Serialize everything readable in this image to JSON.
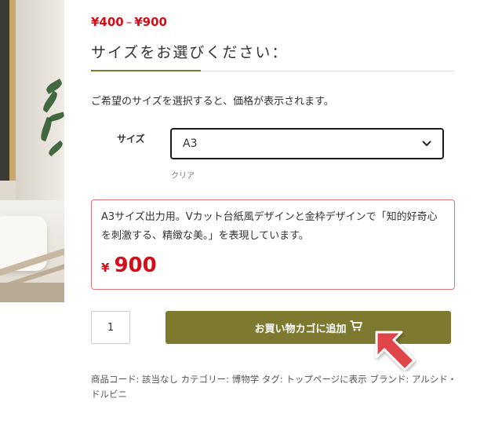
{
  "product": {
    "price_min": "¥400",
    "price_separator": "–",
    "price_max": "¥900"
  },
  "section": {
    "title": "サイズをお選びください："
  },
  "instruction": "ご希望のサイズを選択すると、価格が表示されます。",
  "size_field": {
    "label": "サイズ",
    "selected_value": "A3",
    "clear_label": "クリア"
  },
  "variation": {
    "description": "A3サイズ出力用。Vカット台紙風デザインと金枠デザインで「知的好奇心を刺激する、精緻な美。」を表現しています。",
    "currency": "¥",
    "price": "900"
  },
  "cart": {
    "quantity": "1",
    "add_button_label": "お買い物カゴに追加"
  },
  "meta": {
    "text": "商品コード: 該当なし カテゴリー: 博物学 タグ: トップページに表示 ブランド: アルシド・ドルビニ"
  },
  "colors": {
    "price_red": "#d80c18",
    "accent_olive": "#7d7a30",
    "box_border": "#e0747c",
    "arrow_red": "#e0454a"
  },
  "icons": {
    "select_arrow": "chevron-down-icon",
    "cart": "cart-icon",
    "pointer": "arrow-pointer-icon"
  }
}
